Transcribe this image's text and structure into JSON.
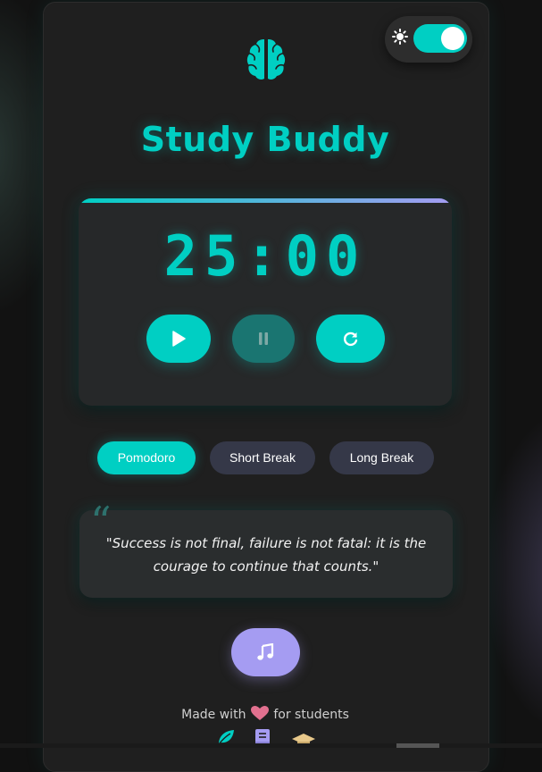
{
  "app": {
    "title": "Study Buddy"
  },
  "theme_toggle": {
    "icon": "sun-icon",
    "state": "on"
  },
  "timer": {
    "display": "25:00",
    "controls": [
      {
        "name": "start-button",
        "icon": "play-icon"
      },
      {
        "name": "pause-button",
        "icon": "pause-icon",
        "state": "disabled"
      },
      {
        "name": "reset-button",
        "icon": "refresh-icon"
      }
    ]
  },
  "modes": {
    "pomodoro": "Pomodoro",
    "short_break": "Short Break",
    "long_break": "Long Break",
    "active": "Pomodoro"
  },
  "quote": {
    "text": "\"Success is not final, failure is not fatal: it is the courage to continue that counts.\""
  },
  "music": {
    "icon": "music-note-icon"
  },
  "footer": {
    "prefix": "Made with",
    "suffix": "for students",
    "icons": [
      "leaf-icon",
      "book-icon",
      "graduation-cap-icon"
    ]
  },
  "colors": {
    "accent": "#00cfc3",
    "secondary": "#a59cf2",
    "heart": "#e2708f",
    "inactive_mode": "#353848"
  }
}
